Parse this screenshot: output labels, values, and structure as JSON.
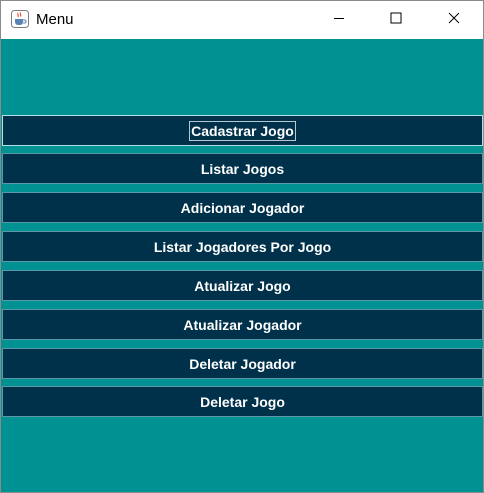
{
  "window": {
    "title": "Menu",
    "controls": {
      "minimize_icon": "minimize-icon",
      "maximize_icon": "maximize-icon",
      "close_icon": "close-icon"
    }
  },
  "menu": {
    "focused_index": 0,
    "items": [
      {
        "label": "Cadastrar Jogo"
      },
      {
        "label": "Listar Jogos"
      },
      {
        "label": "Adicionar Jogador"
      },
      {
        "label": "Listar Jogadores Por Jogo"
      },
      {
        "label": "Atualizar Jogo"
      },
      {
        "label": "Atualizar Jogador"
      },
      {
        "label": "Deletar Jogador"
      },
      {
        "label": "Deletar Jogo"
      }
    ]
  },
  "colors": {
    "background": "#009193",
    "button": "#00314b",
    "button_text": "#ffffff"
  }
}
